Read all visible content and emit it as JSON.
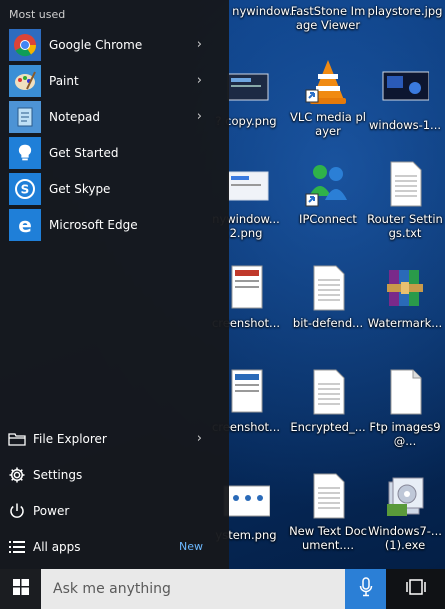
{
  "start_menu": {
    "most_used_heading": "Most used",
    "apps": [
      {
        "label": "Google Chrome",
        "icon": "chrome-icon",
        "tile_color": "#2d6cbf",
        "has_submenu": true
      },
      {
        "label": "Paint",
        "icon": "paint-icon",
        "tile_color": "#3b8fd6",
        "has_submenu": true
      },
      {
        "label": "Notepad",
        "icon": "notepad-icon",
        "tile_color": "#4d93d5",
        "has_submenu": true
      },
      {
        "label": "Get Started",
        "icon": "lightbulb-icon",
        "tile_color": "#1f7fd8",
        "has_submenu": false
      },
      {
        "label": "Get Skype",
        "icon": "skype-icon",
        "tile_color": "#1f7fd8",
        "has_submenu": false
      },
      {
        "label": "Microsoft Edge",
        "icon": "edge-icon",
        "tile_color": "#1f7fd8",
        "has_submenu": false
      }
    ],
    "system": [
      {
        "label": "File Explorer",
        "icon": "folder-icon",
        "has_submenu": true
      },
      {
        "label": "Settings",
        "icon": "gear-icon",
        "has_submenu": false
      },
      {
        "label": "Power",
        "icon": "power-icon",
        "has_submenu": false
      },
      {
        "label": "All apps",
        "icon": "list-icon",
        "badge": "New"
      }
    ]
  },
  "desktop_icons": [
    {
      "label": "nywindow..."
    },
    {
      "label": "FastStone Image Viewer"
    },
    {
      "label": "playstore.jpg"
    },
    {
      "label": "? copy.png"
    },
    {
      "label": "VLC media player"
    },
    {
      "label": "windows-1..."
    },
    {
      "label": "nywindow... 2.png"
    },
    {
      "label": "IPConnect"
    },
    {
      "label": "Router Settings.txt"
    },
    {
      "label": "creenshot..."
    },
    {
      "label": "bit-defend..."
    },
    {
      "label": "Watermark..."
    },
    {
      "label": "creenshot..."
    },
    {
      "label": "Encrypted_..."
    },
    {
      "label": "Ftp images9@..."
    },
    {
      "label": "ystem.png"
    },
    {
      "label": "New Text Document...."
    },
    {
      "label": "Windows7-... (1).exe"
    }
  ],
  "taskbar": {
    "search_placeholder": "Ask me anything",
    "search_accent": "#2b7fd6"
  }
}
